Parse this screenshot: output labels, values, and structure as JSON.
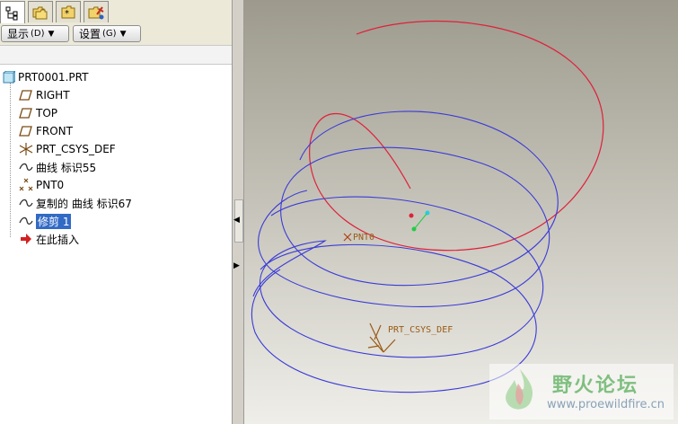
{
  "navigator": {
    "tabs": [
      {
        "name": "model-tree-tab-icon"
      },
      {
        "name": "folder-browser-tab-icon"
      },
      {
        "name": "favorites-tab-icon"
      },
      {
        "name": "connections-tab-icon"
      }
    ],
    "show_button": {
      "label": "显示",
      "shortcut": "(D)"
    },
    "settings_button": {
      "label": "设置",
      "shortcut": "(G)"
    }
  },
  "model_tree": {
    "root": "PRT0001.PRT",
    "items": [
      {
        "label": "RIGHT",
        "icon": "datum-plane-icon"
      },
      {
        "label": "TOP",
        "icon": "datum-plane-icon"
      },
      {
        "label": "FRONT",
        "icon": "datum-plane-icon"
      },
      {
        "label": "PRT_CSYS_DEF",
        "icon": "csys-icon"
      },
      {
        "label": "曲线 标识55",
        "icon": "curve-icon"
      },
      {
        "label": "PNT0",
        "icon": "datum-point-icon"
      },
      {
        "label": "复制的 曲线 标识67",
        "icon": "curve-icon"
      },
      {
        "label": "修剪 1",
        "icon": "curve-icon",
        "selected": true
      },
      {
        "label": "在此插入",
        "icon": "insert-here-arrow-icon"
      }
    ]
  },
  "viewport": {
    "labels": {
      "point": "PNT0",
      "csys": "PRT_CSYS_DEF"
    },
    "colors": {
      "red_curve": "#e0203a",
      "blue_curve": "#3a3ad8",
      "label_color": "#9a5a14"
    }
  },
  "watermark": {
    "title": "野火论坛",
    "url": "www.proewildfire.cn"
  }
}
